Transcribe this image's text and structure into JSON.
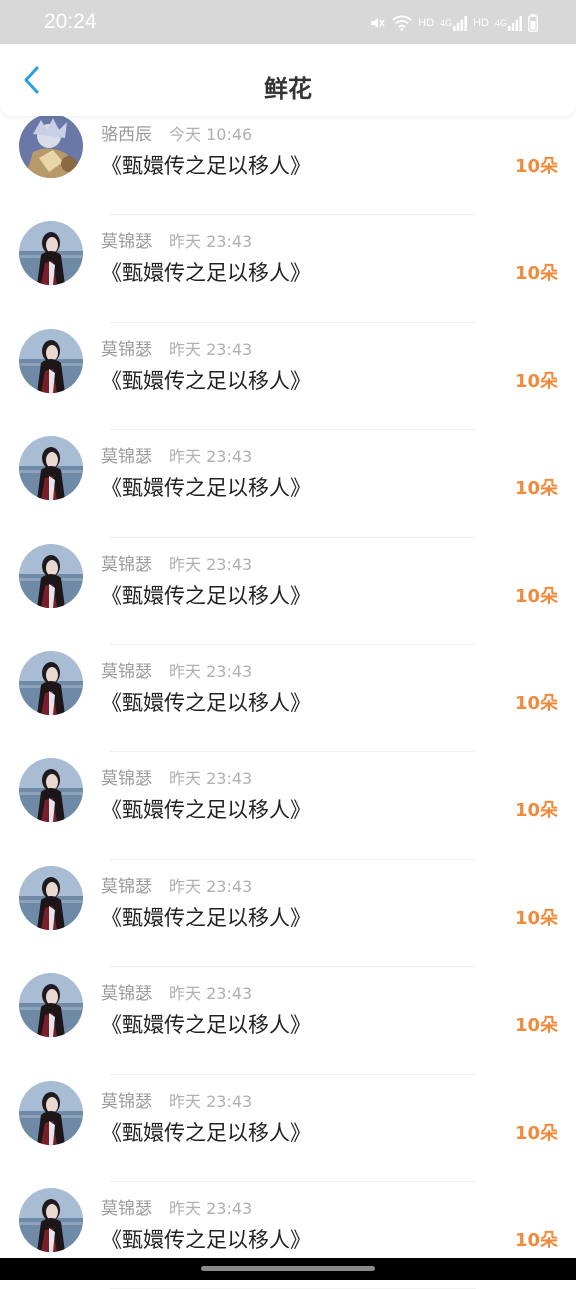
{
  "status": {
    "time": "20:24",
    "icons": [
      "mute-icon",
      "wifi-icon",
      "hd-icon",
      "signal-icon",
      "hd-icon",
      "signal-icon",
      "battery-icon"
    ],
    "hd_label": "HD",
    "net_label": "4G"
  },
  "header": {
    "title": "鲜花",
    "back_icon": "chevron-left-icon",
    "accent": "#2f9ee0"
  },
  "list": {
    "count_color": "#f08a3c",
    "items": [
      {
        "name": "骆西辰",
        "time": "今天 10:46",
        "book": "《甄嬛传之足以移人》",
        "count": "10朵",
        "avatar": "anime-avatar"
      },
      {
        "name": "莫锦瑟",
        "time": "昨天 23:43",
        "book": "《甄嬛传之足以移人》",
        "count": "10朵",
        "avatar": "girl-avatar"
      },
      {
        "name": "莫锦瑟",
        "time": "昨天 23:43",
        "book": "《甄嬛传之足以移人》",
        "count": "10朵",
        "avatar": "girl-avatar"
      },
      {
        "name": "莫锦瑟",
        "time": "昨天 23:43",
        "book": "《甄嬛传之足以移人》",
        "count": "10朵",
        "avatar": "girl-avatar"
      },
      {
        "name": "莫锦瑟",
        "time": "昨天 23:43",
        "book": "《甄嬛传之足以移人》",
        "count": "10朵",
        "avatar": "girl-avatar"
      },
      {
        "name": "莫锦瑟",
        "time": "昨天 23:43",
        "book": "《甄嬛传之足以移人》",
        "count": "10朵",
        "avatar": "girl-avatar"
      },
      {
        "name": "莫锦瑟",
        "time": "昨天 23:43",
        "book": "《甄嬛传之足以移人》",
        "count": "10朵",
        "avatar": "girl-avatar"
      },
      {
        "name": "莫锦瑟",
        "time": "昨天 23:43",
        "book": "《甄嬛传之足以移人》",
        "count": "10朵",
        "avatar": "girl-avatar"
      },
      {
        "name": "莫锦瑟",
        "time": "昨天 23:43",
        "book": "《甄嬛传之足以移人》",
        "count": "10朵",
        "avatar": "girl-avatar"
      },
      {
        "name": "莫锦瑟",
        "time": "昨天 23:43",
        "book": "《甄嬛传之足以移人》",
        "count": "10朵",
        "avatar": "girl-avatar"
      },
      {
        "name": "莫锦瑟",
        "time": "昨天 23:43",
        "book": "《甄嬛传之足以移人》",
        "count": "10朵",
        "avatar": "girl-avatar"
      }
    ]
  }
}
